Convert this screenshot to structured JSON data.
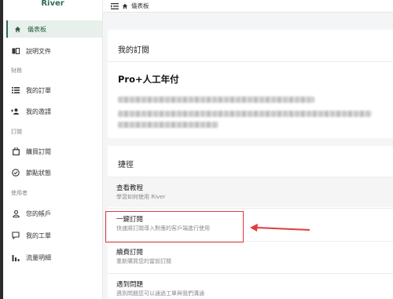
{
  "app": {
    "brand": "River"
  },
  "breadcrumb": {
    "current": "儀表板"
  },
  "sidebar": {
    "items": [
      {
        "label": "儀表板",
        "icon": "home-icon"
      },
      {
        "label": "說明文件",
        "icon": "book-icon"
      },
      {
        "group": "財務"
      },
      {
        "label": "我的訂單",
        "icon": "list-icon"
      },
      {
        "label": "我的邀請",
        "icon": "users-icon"
      },
      {
        "group": "訂閱"
      },
      {
        "label": "購買訂閱",
        "icon": "bag-icon"
      },
      {
        "label": "節點狀態",
        "icon": "check-circle-icon"
      },
      {
        "group": "使用者"
      },
      {
        "label": "您的帳戶",
        "icon": "user-icon"
      },
      {
        "label": "我的工單",
        "icon": "chat-icon"
      },
      {
        "label": "流量明細",
        "icon": "bar-chart-icon"
      }
    ]
  },
  "subscription": {
    "title": "我的訂閱",
    "plan": "Pro+人工年付"
  },
  "shortcuts": {
    "title": "捷徑",
    "items": [
      {
        "title": "查看教程",
        "desc": "學習如何使用 River"
      },
      {
        "title": "一鍵訂閱",
        "desc": "快速將訂閱導入對應的客戶端進行使用"
      },
      {
        "title": "續費訂閱",
        "desc": "重新購買您的當前訂閱"
      },
      {
        "title": "遇到問題",
        "desc": "遇到問題您可以通過工單與我們溝通"
      }
    ]
  },
  "colors": {
    "accent": "#2f6b53",
    "highlight_box": "#e23b3b"
  }
}
